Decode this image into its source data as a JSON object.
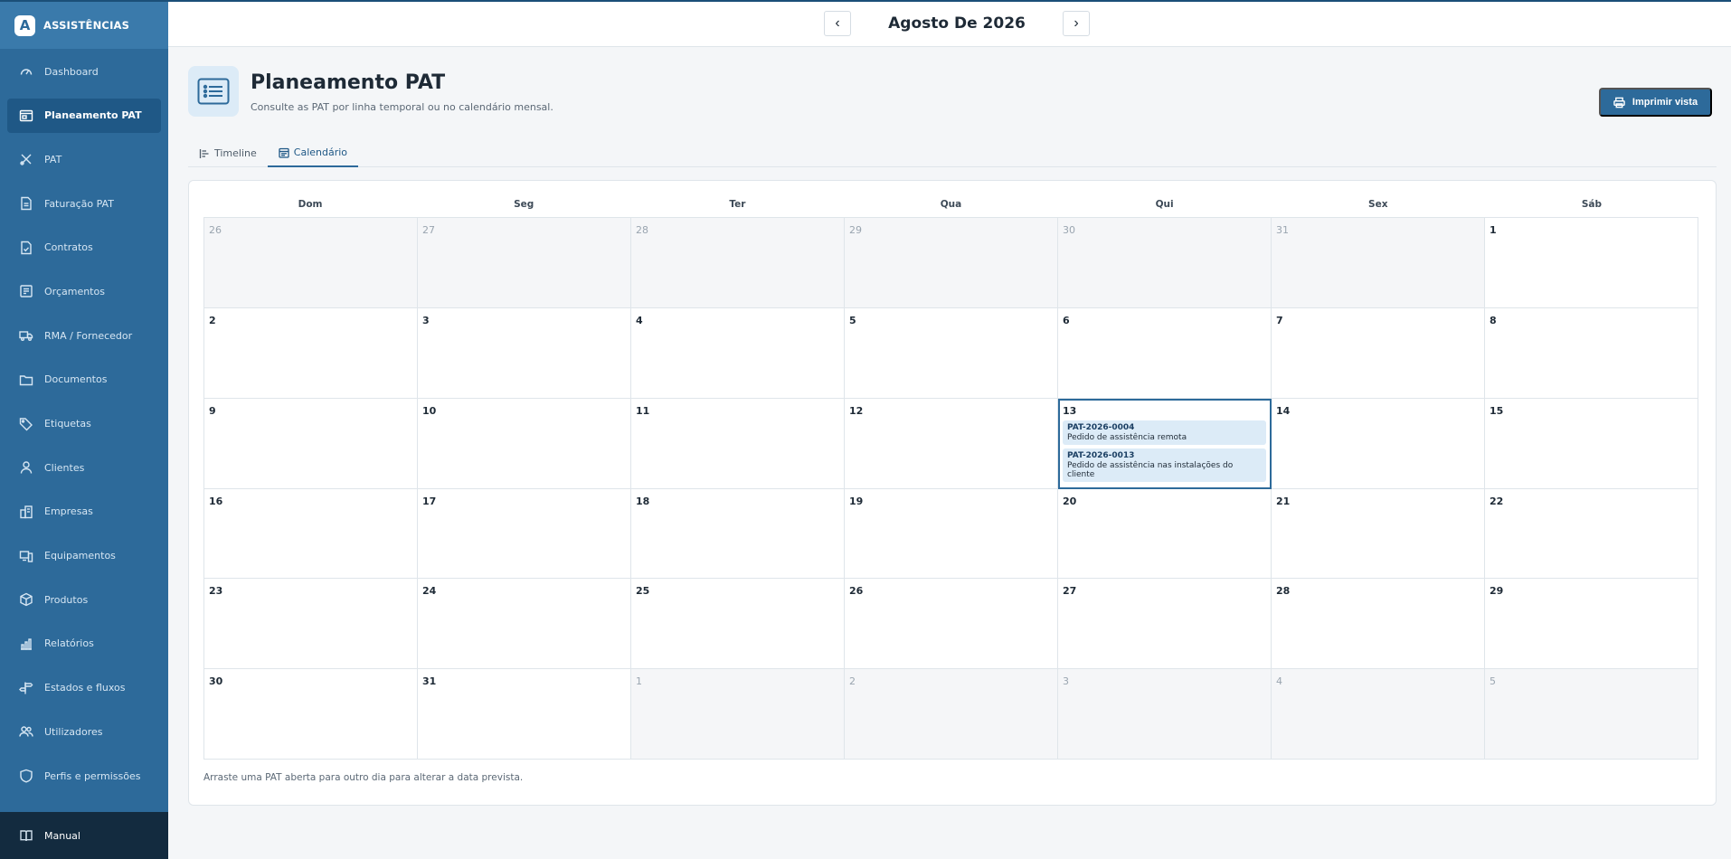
{
  "brand": {
    "logo_letter": "A",
    "name": "ASSISTÊNCIAS"
  },
  "sidebar": {
    "items": [
      {
        "label": "Dashboard",
        "icon": "gauge-icon",
        "active": false
      },
      {
        "label": "Planeamento PAT",
        "icon": "calendar-board-icon",
        "active": true
      },
      {
        "label": "PAT",
        "icon": "tools-icon",
        "active": false
      },
      {
        "label": "Faturação PAT",
        "icon": "invoice-icon",
        "active": false
      },
      {
        "label": "Contratos",
        "icon": "contract-icon",
        "active": false
      },
      {
        "label": "Orçamentos",
        "icon": "budget-icon",
        "active": false
      },
      {
        "label": "RMA / Fornecedor",
        "icon": "truck-icon",
        "active": false
      },
      {
        "label": "Documentos",
        "icon": "folder-icon",
        "active": false
      },
      {
        "label": "Etiquetas",
        "icon": "tag-icon",
        "active": false
      },
      {
        "label": "Clientes",
        "icon": "user-icon",
        "active": false
      },
      {
        "label": "Empresas",
        "icon": "building-icon",
        "active": false
      },
      {
        "label": "Equipamentos",
        "icon": "devices-icon",
        "active": false
      },
      {
        "label": "Produtos",
        "icon": "box-icon",
        "active": false
      },
      {
        "label": "Relatórios",
        "icon": "bar-chart-icon",
        "active": false
      },
      {
        "label": "Estados e fluxos",
        "icon": "signpost-icon",
        "active": false
      },
      {
        "label": "Utilizadores",
        "icon": "users-icon",
        "active": false
      },
      {
        "label": "Perfis e permissões",
        "icon": "shield-icon",
        "active": false
      }
    ],
    "manual_label": "Manual"
  },
  "topbar": {
    "prev": "‹",
    "next": "›",
    "month_title": "Agosto De 2026"
  },
  "page": {
    "title": "Planeamento PAT",
    "subtitle": "Consulte as PAT por linha temporal ou no calendário mensal.",
    "print_label": "Imprimir vista"
  },
  "tabs": [
    {
      "label": "Timeline",
      "active": false
    },
    {
      "label": "Calendário",
      "active": true
    }
  ],
  "calendar": {
    "weekdays": [
      "Dom",
      "Seg",
      "Ter",
      "Qua",
      "Qui",
      "Sex",
      "Sáb"
    ],
    "days": [
      {
        "n": "26",
        "other": true
      },
      {
        "n": "27",
        "other": true
      },
      {
        "n": "28",
        "other": true
      },
      {
        "n": "29",
        "other": true
      },
      {
        "n": "30",
        "other": true
      },
      {
        "n": "31",
        "other": true
      },
      {
        "n": "1",
        "other": false
      },
      {
        "n": "2",
        "other": false
      },
      {
        "n": "3",
        "other": false
      },
      {
        "n": "4",
        "other": false
      },
      {
        "n": "5",
        "other": false
      },
      {
        "n": "6",
        "other": false
      },
      {
        "n": "7",
        "other": false
      },
      {
        "n": "8",
        "other": false
      },
      {
        "n": "9",
        "other": false
      },
      {
        "n": "10",
        "other": false
      },
      {
        "n": "11",
        "other": false
      },
      {
        "n": "12",
        "other": false
      },
      {
        "n": "13",
        "other": false,
        "selected": true,
        "events": [
          {
            "id": "PAT-2026-0004",
            "desc": "Pedido de assistência remota"
          },
          {
            "id": "PAT-2026-0013",
            "desc": "Pedido de assistência nas instalações do cliente"
          }
        ]
      },
      {
        "n": "14",
        "other": false
      },
      {
        "n": "15",
        "other": false
      },
      {
        "n": "16",
        "other": false
      },
      {
        "n": "17",
        "other": false
      },
      {
        "n": "18",
        "other": false
      },
      {
        "n": "19",
        "other": false
      },
      {
        "n": "20",
        "other": false
      },
      {
        "n": "21",
        "other": false
      },
      {
        "n": "22",
        "other": false
      },
      {
        "n": "23",
        "other": false
      },
      {
        "n": "24",
        "other": false
      },
      {
        "n": "25",
        "other": false
      },
      {
        "n": "26",
        "other": false
      },
      {
        "n": "27",
        "other": false
      },
      {
        "n": "28",
        "other": false
      },
      {
        "n": "29",
        "other": false
      },
      {
        "n": "30",
        "other": false
      },
      {
        "n": "31",
        "other": false
      },
      {
        "n": "1",
        "other": true
      },
      {
        "n": "2",
        "other": true
      },
      {
        "n": "3",
        "other": true
      },
      {
        "n": "4",
        "other": true
      },
      {
        "n": "5",
        "other": true
      }
    ],
    "footer_note": "Arraste uma PAT aberta para outro dia para alterar a data prevista."
  },
  "colors": {
    "sidebar": "#2d6a9a",
    "accent": "#2d6a9a",
    "event_bg": "#dcebf7"
  }
}
